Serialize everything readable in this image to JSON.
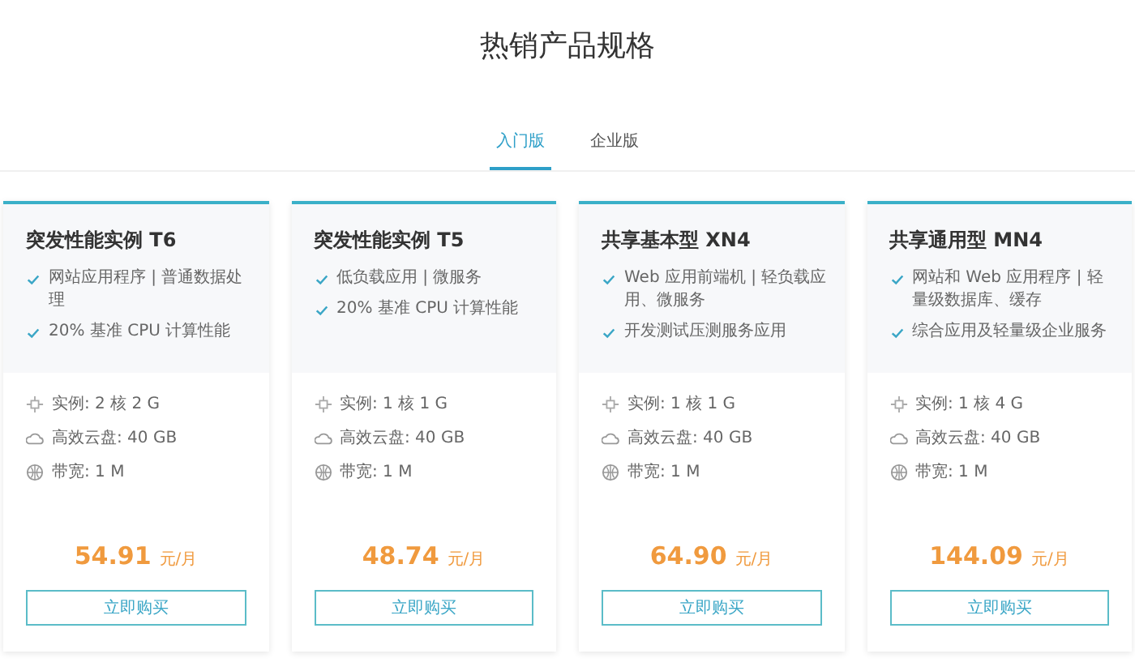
{
  "title": "热销产品规格",
  "tabs": [
    {
      "label": "入门版",
      "selected": true
    },
    {
      "label": "企业版",
      "selected": false
    }
  ],
  "cards": [
    {
      "name": "突发性能实例 T6",
      "features": [
        "网站应用程序 | 普通数据处理",
        "20% 基准 CPU 计算性能"
      ],
      "specs": [
        {
          "kind": "cpu",
          "text": "实例: 2 核 2 G"
        },
        {
          "kind": "disk",
          "text": "高效云盘: 40 GB"
        },
        {
          "kind": "bandwidth",
          "text": "带宽: 1 M"
        }
      ],
      "price": "54.91",
      "unit": "元/月",
      "button": "立即购买"
    },
    {
      "name": "突发性能实例 T5",
      "features": [
        "低负载应用 | 微服务",
        "20% 基准 CPU 计算性能"
      ],
      "specs": [
        {
          "kind": "cpu",
          "text": "实例: 1 核 1 G"
        },
        {
          "kind": "disk",
          "text": "高效云盘: 40 GB"
        },
        {
          "kind": "bandwidth",
          "text": "带宽: 1 M"
        }
      ],
      "price": "48.74",
      "unit": "元/月",
      "button": "立即购买"
    },
    {
      "name": "共享基本型 XN4",
      "features": [
        "Web 应用前端机 | 轻负载应用、微服务",
        "开发测试压测服务应用"
      ],
      "specs": [
        {
          "kind": "cpu",
          "text": "实例: 1 核 1 G"
        },
        {
          "kind": "disk",
          "text": "高效云盘: 40 GB"
        },
        {
          "kind": "bandwidth",
          "text": "带宽: 1 M"
        }
      ],
      "price": "64.90",
      "unit": "元/月",
      "button": "立即购买"
    },
    {
      "name": "共享通用型 MN4",
      "features": [
        "网站和 Web 应用程序 | 轻量级数据库、缓存",
        "综合应用及轻量级企业服务"
      ],
      "specs": [
        {
          "kind": "cpu",
          "text": "实例: 1 核 4 G"
        },
        {
          "kind": "disk",
          "text": "高效云盘: 40 GB"
        },
        {
          "kind": "bandwidth",
          "text": "带宽: 1 M"
        }
      ],
      "price": "144.09",
      "unit": "元/月",
      "button": "立即购买"
    }
  ]
}
